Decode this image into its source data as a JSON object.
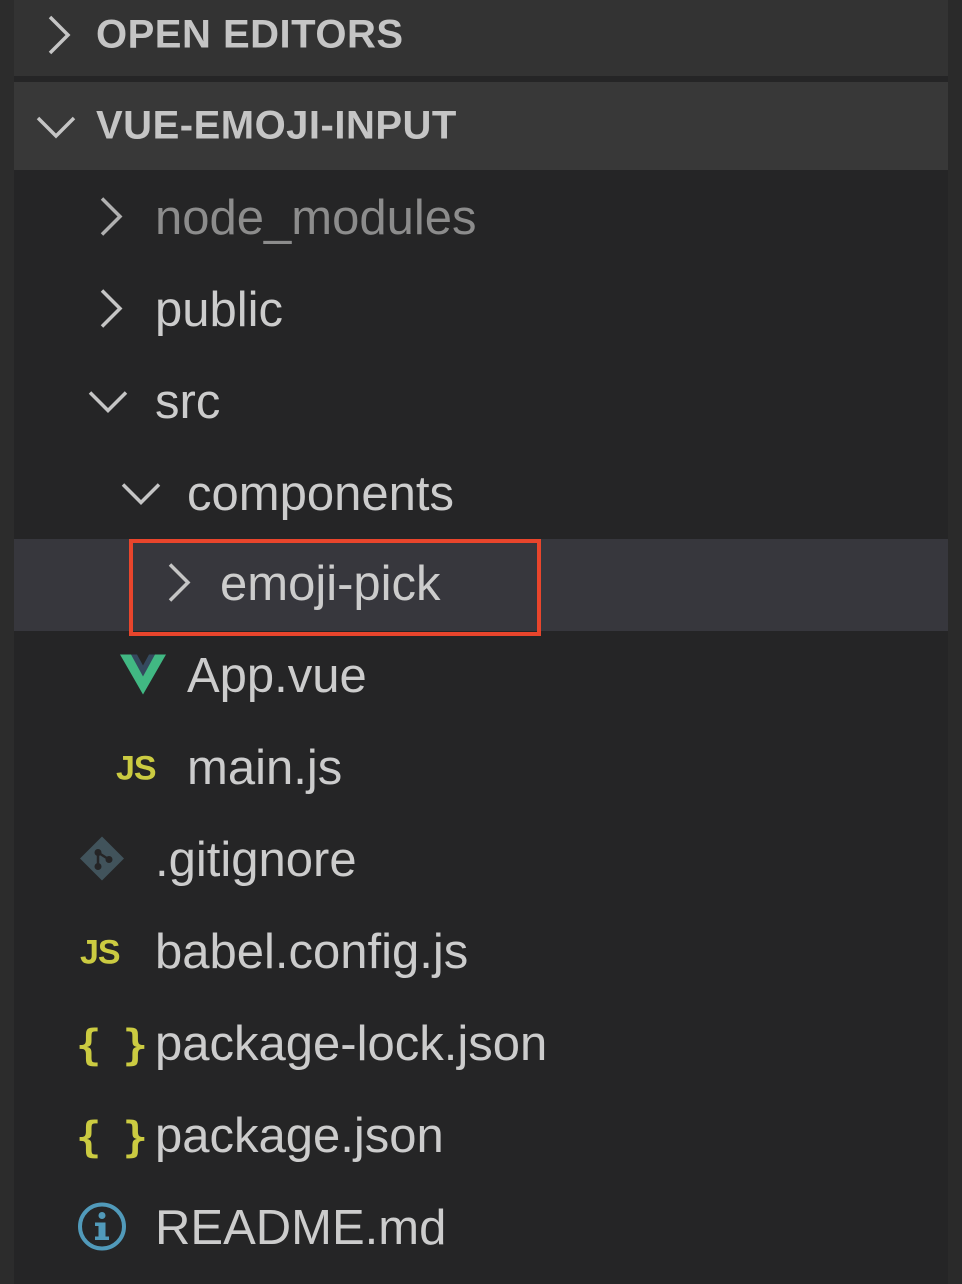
{
  "explorer": {
    "sections": [
      {
        "label": "OPEN EDITORS",
        "expanded": false,
        "icon": "chevron-right-icon"
      },
      {
        "label": "VUE-EMOJI-INPUT",
        "expanded": true,
        "icon": "chevron-down-icon"
      }
    ],
    "tree": [
      {
        "name": "node_modules",
        "type": "folder",
        "expanded": false,
        "muted": true,
        "icon": "chevron-right-icon"
      },
      {
        "name": "public",
        "type": "folder",
        "expanded": false,
        "icon": "chevron-right-icon"
      },
      {
        "name": "src",
        "type": "folder",
        "expanded": true,
        "icon": "chevron-down-icon"
      },
      {
        "name": "components",
        "type": "folder",
        "expanded": true,
        "icon": "chevron-down-icon"
      },
      {
        "name": "emoji-pick",
        "type": "folder",
        "expanded": false,
        "selected": true,
        "highlighted": true,
        "icon": "chevron-right-icon"
      },
      {
        "name": "App.vue",
        "type": "file",
        "icon": "vue-icon"
      },
      {
        "name": "main.js",
        "type": "file",
        "icon": "javascript-icon",
        "icon_text": "JS"
      },
      {
        "name": ".gitignore",
        "type": "file",
        "icon": "git-icon"
      },
      {
        "name": "babel.config.js",
        "type": "file",
        "icon": "javascript-icon",
        "icon_text": "JS"
      },
      {
        "name": "package-lock.json",
        "type": "file",
        "icon": "json-icon",
        "icon_text": "{ }"
      },
      {
        "name": "package.json",
        "type": "file",
        "icon": "json-icon",
        "icon_text": "{ }"
      },
      {
        "name": "README.md",
        "type": "file",
        "icon": "info-icon"
      }
    ]
  },
  "colors": {
    "background": "#252526",
    "header_background": "#383838",
    "selected_row": "#37373d",
    "text": "#cccccc",
    "muted_text": "#8c8c8c",
    "js_yellow": "#cbcb41",
    "vue_green": "#41b883",
    "git_slate": "#41535b",
    "info_blue": "#519aba",
    "highlight_outline": "#e8452c"
  }
}
